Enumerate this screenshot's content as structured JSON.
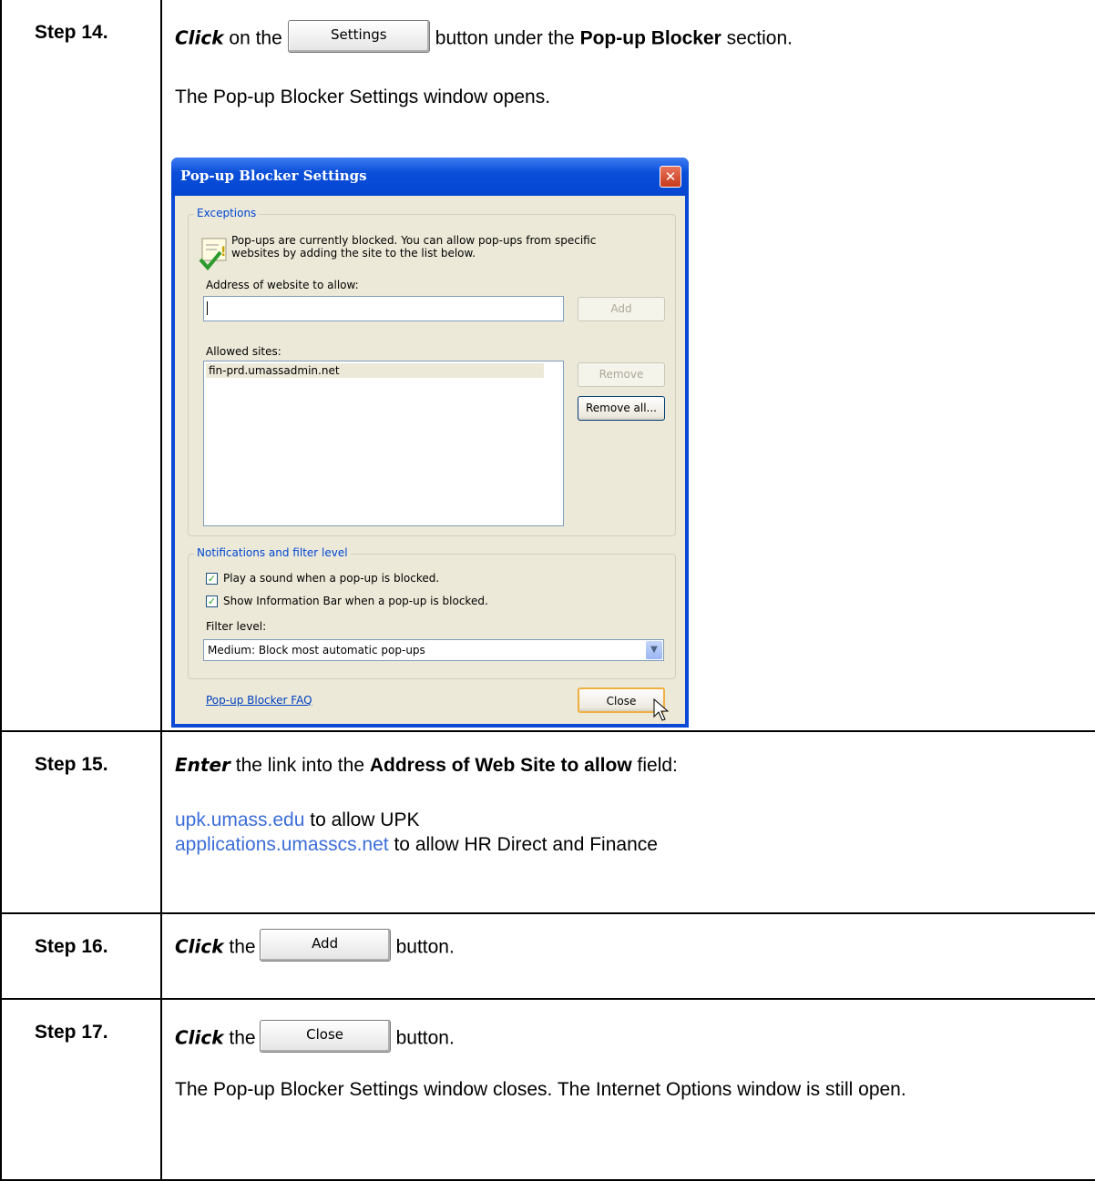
{
  "steps": [
    {
      "label": "Step 14."
    },
    {
      "label": "Step 15."
    },
    {
      "label": "Step 16."
    },
    {
      "label": "Step 17."
    }
  ],
  "step14": {
    "verb": "Click",
    "text_on_the": "on the",
    "button_label": "Settings",
    "text_under": "button under the",
    "section_name": "Pop-up Blocker",
    "text_section": "section.",
    "result": "The Pop-up Blocker Settings window opens."
  },
  "dialog": {
    "title": "Pop-up Blocker Settings",
    "close_glyph": "✕",
    "exceptions_legend": "Exceptions",
    "info_text_1": "Pop-ups are currently blocked.  You can allow pop-ups from specific",
    "info_text_2": "websites by adding the site to the list below.",
    "address_label": "Address of website to allow:",
    "address_value": "",
    "add_button": "Add",
    "allowed_label": "Allowed sites:",
    "allowed_sites": [
      "fin-prd.umassadmin.net"
    ],
    "remove_button": "Remove",
    "remove_all_button": "Remove all...",
    "notifications_legend": "Notifications and filter level",
    "check_sound": "Play a sound when a pop-up is blocked.",
    "check_infobar": "Show Information Bar when a pop-up is blocked.",
    "filter_label": "Filter level:",
    "filter_value": "Medium: Block most automatic pop-ups",
    "faq_link": "Pop-up Blocker FAQ",
    "close_button": "Close"
  },
  "step15": {
    "verb": "Enter",
    "text_1": "the link into the",
    "field_name": "Address of Web Site to allow",
    "text_2": "field:",
    "link_1": "upk.umass.edu",
    "link_1_text": "to  allow UPK",
    "link_2": "applications.umasscs.net",
    "link_2_text": "to allow HR Direct and Finance"
  },
  "step16": {
    "verb": "Click",
    "text_the": "the",
    "button_label": "Add",
    "text_button": "button."
  },
  "step17": {
    "verb": "Click",
    "text_the": "the",
    "button_label": "Close",
    "text_button": "button.",
    "result": "The Pop-up Blocker Settings window closes.  The Internet Options window is still open."
  }
}
